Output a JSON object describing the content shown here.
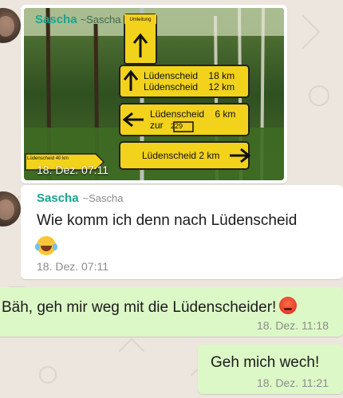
{
  "messages": {
    "photo": {
      "sender": "Sascha",
      "tag": "~Sascha",
      "time": "18. Dez. 07:11",
      "sign_header": "Umleitung",
      "sign_rows": [
        {
          "place": "Lüdenscheid",
          "dist": "18 km"
        },
        {
          "place": "Lüdenscheid",
          "dist": "12 km"
        }
      ],
      "sign_left": {
        "place": "Lüdenscheid",
        "dist": "6 km",
        "via": "zur",
        "road": "229"
      },
      "sign_right": {
        "place": "Lüdenscheid",
        "dist": "2 km"
      },
      "sign_small": {
        "place": "Lüdenscheid",
        "dist": "40 km"
      }
    },
    "text1": {
      "sender": "Sascha",
      "tag": "~Sascha",
      "text": "Wie komm ich denn nach Lüdenscheid",
      "emoji": "face-with-tears-of-joy",
      "time": "18. Dez. 07:11"
    },
    "out1": {
      "text": "Bäh, geh mir weg mit die Lüdenscheider!",
      "emoji": "angry-face",
      "time": "18. Dez. 11:18"
    },
    "out2": {
      "text": "Geh mich wech!",
      "time": "18. Dez. 11:21"
    }
  },
  "colors": {
    "background": "#ece6de",
    "incoming_bubble": "#ffffff",
    "outgoing_bubble": "#dcf8c6",
    "sender_name": "#1aa38f",
    "sign_yellow": "#f2d21b"
  }
}
